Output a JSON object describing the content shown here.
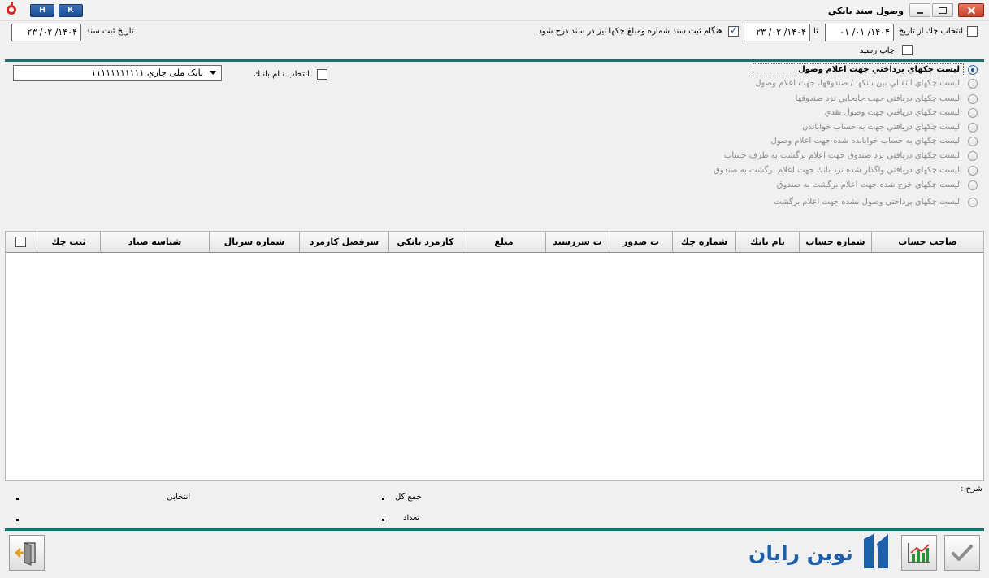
{
  "window": {
    "title": "وصول سند بانكي",
    "lang_buttons": [
      "H",
      "K"
    ]
  },
  "filters": {
    "select_check_from_date_label": "انتخاب چك از تاريخ",
    "from_date": "۱۴۰۴/ ۰۱/ ۰۱",
    "to_label": "تا",
    "to_date": "۱۴۰۴/ ۰۲/ ۲۳",
    "include_numbers_label": "هنگام ثبت سند شماره ومبلغ چكها نيز در سند درج شود",
    "include_numbers_checked": true,
    "register_date_label": "تاريخ ثبت سند",
    "register_date": "۱۴۰۴/ ۰۲/ ۲۳",
    "print_receipt_label": "چاپ رسيد",
    "print_receipt_checked": false
  },
  "bank": {
    "select_bank_label": "انتخاب نـام بانـك",
    "select_bank_checked": false,
    "selected_bank": "بانک ملی جاري ۱۱۱۱۱۱۱۱۱۱۱"
  },
  "options": [
    {
      "label": "ليست چكهاي پرداختي جهت اعلام وصول",
      "selected": true
    },
    {
      "label": "ليست چکهاي انتقالي بين بانكها / صندوقها، جهت اعلام وصول",
      "selected": false
    },
    {
      "label": "ليست چكهاي دريافتي جهت جابجايي نزد صندوقها",
      "selected": false
    },
    {
      "label": "ليست چكهاي دريافتي جهت وصول نقدي",
      "selected": false
    },
    {
      "label": "ليست چكهاي دريافتي جهت به حساب خواباندن",
      "selected": false
    },
    {
      "label": "ليست چكهاي به حساب خوابانده شده جهت اعلام وصول",
      "selected": false
    },
    {
      "label": "ليست چكهاي دريافتي نزد صندوق جهت اعلام برگشت به طرف حساب",
      "selected": false
    },
    {
      "label": "ليست چكهاي دريافتي واگذار شده نزد بانك جهت اعلام برگشت به صندوق",
      "selected": false
    },
    {
      "label": "ليست چكهاي خرج شده جهت اعلام برگشت به صندوق",
      "selected": false
    },
    {
      "label": "ليست چكهاي پرداختي وصول نشده جهت اعلام برگشت",
      "selected": false
    }
  ],
  "grid": {
    "columns": [
      "صاحب حساب",
      "شماره حساب",
      "نام بانك",
      "شماره چك",
      "ت صدور",
      "ت سررسيد",
      "مبلغ",
      "كارمزد بانكي",
      "سرفصل كارمزد",
      "شماره سريال",
      "شناسه صياد",
      "ثبت چك"
    ],
    "rows": []
  },
  "footer": {
    "description_label": "شرح :",
    "total_label": "جمع کل",
    "count_label": "تعداد",
    "selected_label": "انتخابی",
    "brand": "نوين رايان"
  }
}
